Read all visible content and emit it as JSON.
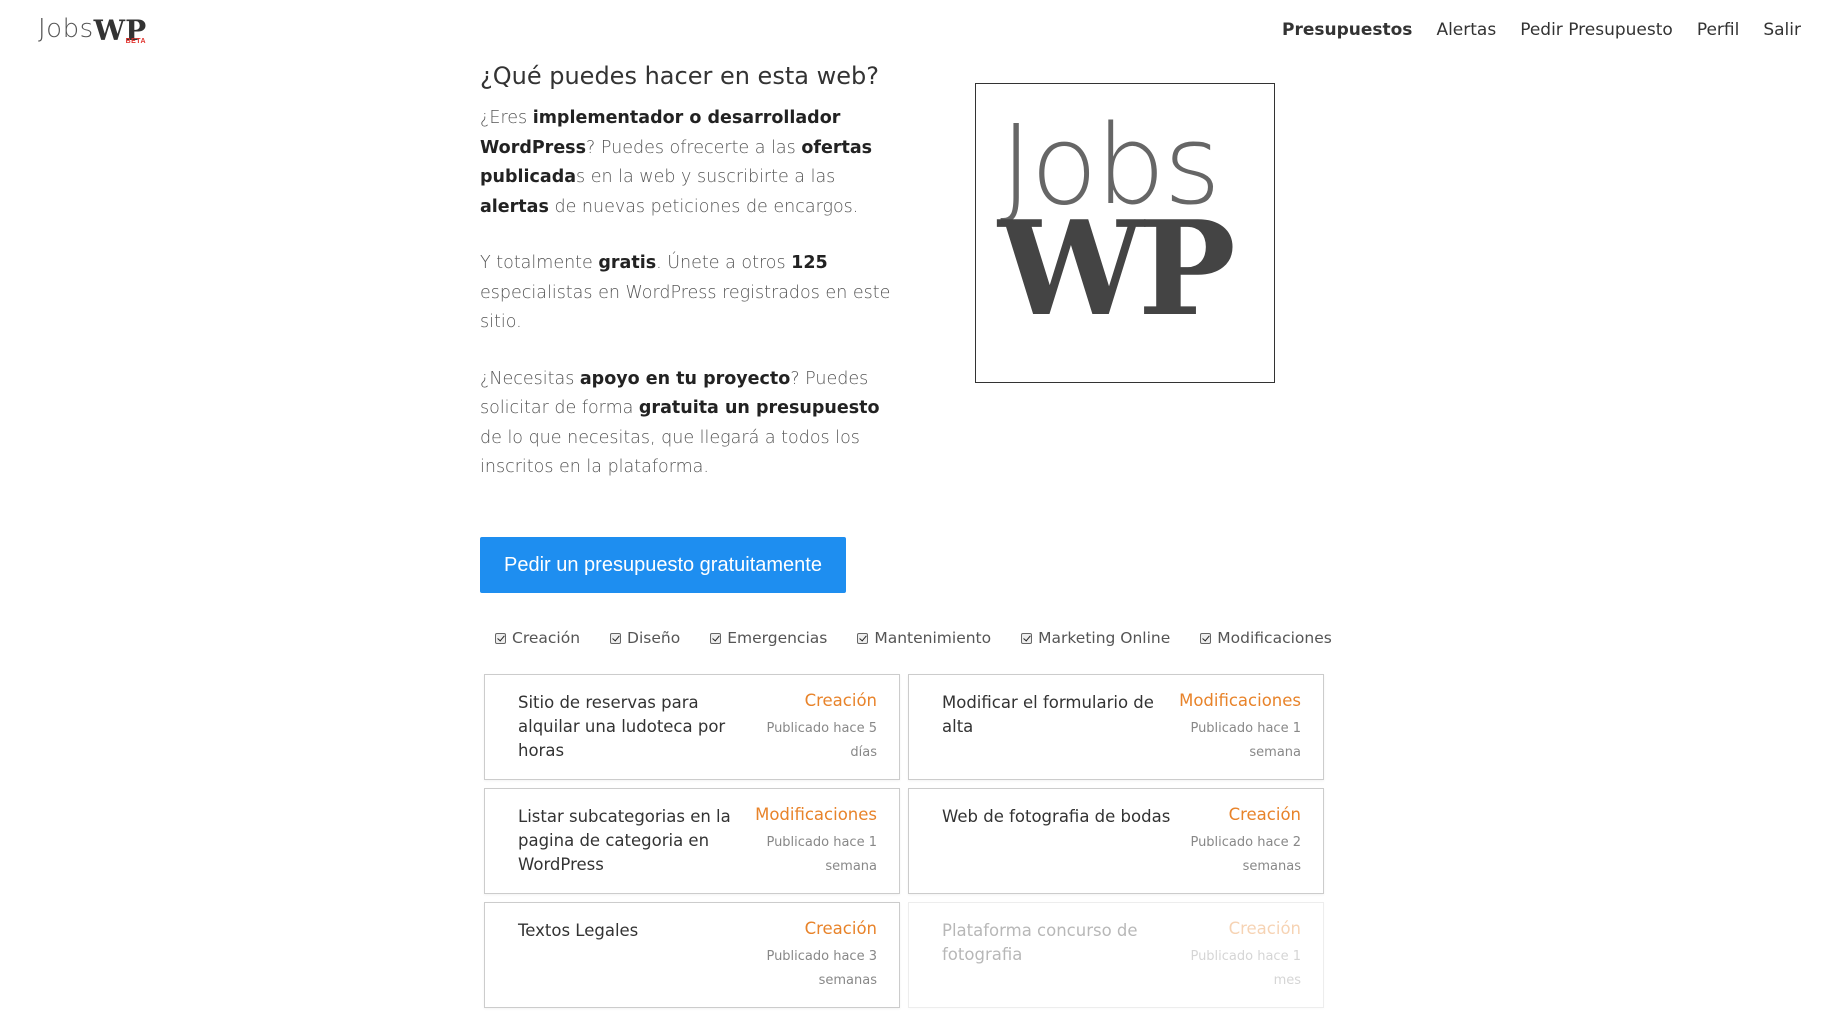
{
  "header": {
    "logo_jobs": "Jobs",
    "logo_wp": "WP",
    "logo_beta": "BETA",
    "nav": [
      {
        "label": "Presupuestos",
        "active": true
      },
      {
        "label": "Alertas"
      },
      {
        "label": "Pedir Presupuesto"
      },
      {
        "label": "Perfil"
      },
      {
        "label": "Salir"
      }
    ]
  },
  "intro": {
    "heading": "¿Qué puedes hacer en esta web?",
    "p1": [
      "¿Eres ",
      "implementador o desarrollador WordPress",
      "? Puedes ofrecerte a las ",
      "ofertas publicada",
      "s en la web y suscribirte a las ",
      "alertas",
      " de nuevas peticiones de encargos."
    ],
    "p2": [
      "Y totalmente ",
      "gratis",
      ". Únete a otros ",
      "125",
      " especialistas en WordPress registrados en este sitio."
    ],
    "p3": [
      "¿Necesitas ",
      "apoyo en tu proyecto",
      "? Puedes solicitar de forma ",
      "gratuita un presupuesto",
      " de lo que necesitas, que llegará a todos los inscritos en la plataforma."
    ]
  },
  "big_logo": {
    "jobs": "Jobs",
    "wp": "WP"
  },
  "cta_label": "Pedir un presupuesto gratuitamente",
  "filters": [
    "Creación",
    "Diseño",
    "Emergencias",
    "Mantenimiento",
    "Marketing Online",
    "Modificaciones"
  ],
  "listings": [
    {
      "title": "Sitio de reservas para alquilar una ludoteca por horas",
      "category": "Creación",
      "date": "Publicado hace 5 días"
    },
    {
      "title": "Modificar el formulario de alta",
      "category": "Modificaciones",
      "date": "Publicado hace 1 semana"
    },
    {
      "title": "Listar subcategorias en la pagina de categoria en WordPress",
      "category": "Modificaciones",
      "date": "Publicado hace 1 semana"
    },
    {
      "title": "Web de fotografia de bodas",
      "category": "Creación",
      "date": "Publicado hace 2 semanas"
    },
    {
      "title": "Textos Legales",
      "category": "Creación",
      "date": "Publicado hace 3 semanas"
    },
    {
      "title": "Plataforma concurso de fotografia",
      "category": "Creación",
      "date": "Publicado hace 1 mes"
    }
  ],
  "colors": {
    "accent": "#1e8ef0",
    "category": "#e8832a"
  }
}
